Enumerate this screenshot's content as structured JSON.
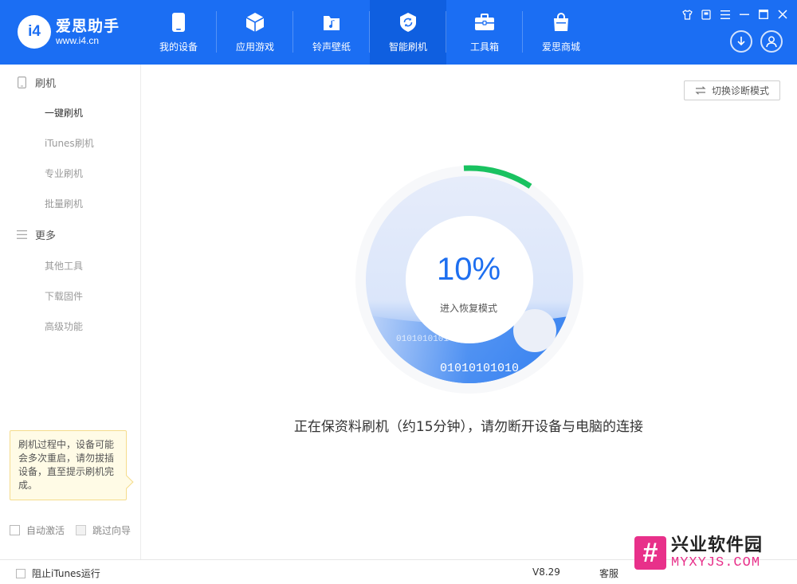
{
  "app": {
    "logo_mark": "i4",
    "name": "爱思助手",
    "url": "www.i4.cn"
  },
  "nav": {
    "items": [
      {
        "label": "我的设备",
        "icon": "phone-icon"
      },
      {
        "label": "应用游戏",
        "icon": "cube-icon"
      },
      {
        "label": "铃声壁纸",
        "icon": "music-folder-icon"
      },
      {
        "label": "智能刷机",
        "icon": "refresh-shield-icon",
        "active": true
      },
      {
        "label": "工具箱",
        "icon": "toolbox-icon"
      },
      {
        "label": "爱思商城",
        "icon": "shopping-bag-icon"
      }
    ]
  },
  "window_controls": [
    "skin-icon",
    "feedback-icon",
    "menu-icon",
    "minimize-icon",
    "maximize-icon",
    "close-icon"
  ],
  "sidebar": {
    "group1": {
      "label": "刷机",
      "icon": "phone-outline-icon"
    },
    "group1_items": [
      {
        "label": "一键刷机",
        "active": true
      },
      {
        "label": "iTunes刷机"
      },
      {
        "label": "专业刷机"
      },
      {
        "label": "批量刷机"
      }
    ],
    "group2": {
      "label": "更多",
      "icon": "list-icon"
    },
    "group2_items": [
      {
        "label": "其他工具"
      },
      {
        "label": "下载固件"
      },
      {
        "label": "高级功能"
      }
    ],
    "tip": "刷机过程中，设备可能会多次重启，请勿拔插设备，直至提示刷机完成。",
    "auto_activate": "自动激活",
    "skip_guide": "跳过向导"
  },
  "main": {
    "diag_button": "切换诊断模式",
    "progress": 10,
    "progress_text": "10%",
    "progress_sub": "进入恢复模式",
    "binary_top": "0101010101",
    "binary_bottom": "01010101010",
    "status": "正在保资料刷机（约15分钟），请勿断开设备与电脑的连接"
  },
  "footer": {
    "block_itunes": "阻止iTunes运行",
    "version": "V8.29",
    "service": "客服"
  },
  "watermark": {
    "mark": "#",
    "cn": "兴业软件园",
    "en": "MYXYJS.COM"
  },
  "colors": {
    "brand": "#1b6ef3",
    "progress": "#19c260",
    "accent_text": "#1e6ff0",
    "watermark": "#e8308a"
  }
}
